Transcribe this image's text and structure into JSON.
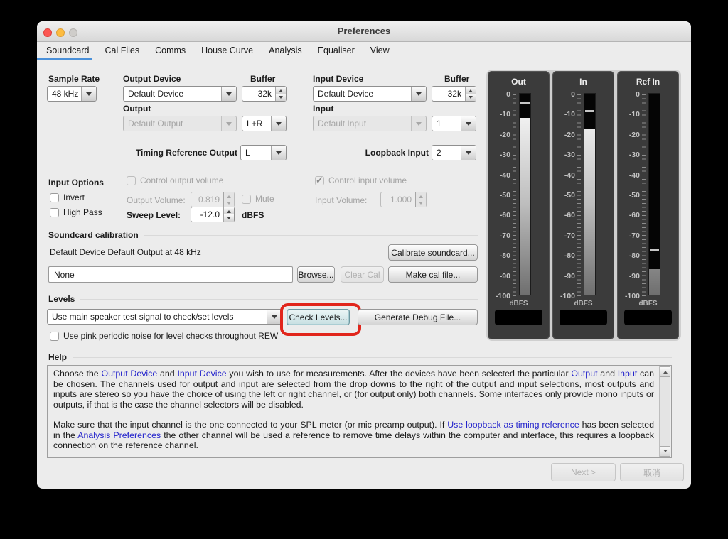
{
  "window": {
    "title": "Preferences"
  },
  "tabs": {
    "items": [
      {
        "label": "Soundcard"
      },
      {
        "label": "Cal Files"
      },
      {
        "label": "Comms"
      },
      {
        "label": "House Curve"
      },
      {
        "label": "Analysis"
      },
      {
        "label": "Equaliser"
      },
      {
        "label": "View"
      }
    ],
    "selected": "Soundcard"
  },
  "controls": {
    "sample_rate_label": "Sample Rate",
    "sample_rate_value": "48 kHz",
    "output_device_label": "Output Device",
    "output_device_value": "Default Device",
    "output_buffer_label": "Buffer",
    "output_buffer_value": "32k",
    "input_device_label": "Input Device",
    "input_device_value": "Default Device",
    "input_buffer_label": "Buffer",
    "input_buffer_value": "32k",
    "output_label": "Output",
    "output_value": "Default Output",
    "output_channel_value": "L+R",
    "input_label": "Input",
    "input_value": "Default Input",
    "input_channel_value": "1",
    "timing_ref_label": "Timing Reference Output",
    "timing_ref_value": "L",
    "loopback_label": "Loopback Input",
    "loopback_value": "2"
  },
  "input_options": {
    "section_label": "Input Options",
    "invert_label": "Invert",
    "high_pass_label": "High Pass",
    "control_output_label": "Control output volume",
    "output_volume_label": "Output Volume:",
    "output_volume_value": "0.819",
    "mute_label": "Mute",
    "sweep_level_label": "Sweep Level:",
    "sweep_level_value": "-12.0",
    "sweep_level_unit": "dBFS",
    "control_input_label": "Control input volume",
    "input_volume_label": "Input Volume:",
    "input_volume_value": "1.000"
  },
  "calibration": {
    "section_label": "Soundcard calibration",
    "status_text": "Default Device Default Output at 48 kHz",
    "file_value": "None",
    "browse_label": "Browse...",
    "clear_label": "Clear Cal",
    "make_label": "Make cal file...",
    "calibrate_label": "Calibrate soundcard..."
  },
  "levels": {
    "section_label": "Levels",
    "signal_select_value": "Use main speaker test signal to check/set levels",
    "check_levels_label": "Check Levels...",
    "generate_debug_label": "Generate Debug File...",
    "pink_noise_label": "Use pink periodic noise for level checks throughout REW"
  },
  "help": {
    "section_label": "Help",
    "paragraphs": [
      [
        {
          "t": "Choose the "
        },
        {
          "t": "Output Device",
          "link": true
        },
        {
          "t": " and "
        },
        {
          "t": "Input Device",
          "link": true
        },
        {
          "t": " you wish to use for measurements. After the devices have been selected the particular "
        },
        {
          "t": "Output",
          "link": true
        },
        {
          "t": " and "
        },
        {
          "t": "Input",
          "link": true
        },
        {
          "t": " can be chosen. The channels used for output and input are selected from the drop downs to the right of the output and input selections, most outputs and inputs are stereo so you have the choice of using the left or right channel, or (for output only) both channels. Some interfaces only provide mono inputs or outputs, if that is the case the channel selectors will be disabled."
        }
      ],
      [
        {
          "t": "Make sure that the input channel is the one connected to your SPL meter (or mic preamp output). If "
        },
        {
          "t": "Use loopback as timing reference",
          "link": true
        },
        {
          "t": " has been selected in the "
        },
        {
          "t": "Analysis Preferences",
          "link": true
        },
        {
          "t": " the other channel will be used a reference to remove time delays within the computer and interface, this requires a loopback connection on the reference channel."
        }
      ]
    ]
  },
  "meters": {
    "unit_label": "dBFS",
    "scale": [
      "0",
      "-10",
      "-20",
      "-30",
      "-40",
      "-50",
      "-60",
      "-70",
      "-80",
      "-90",
      "-100"
    ],
    "items": [
      {
        "label": "Out",
        "level_db": -12,
        "peak_db": -4
      },
      {
        "label": "In",
        "level_db": -17.5,
        "peak_db": -8
      },
      {
        "label": "Ref In",
        "level_db": -87,
        "peak_db": -77
      }
    ]
  },
  "footer": {
    "next_label": "Next >",
    "cancel_label": "取消"
  },
  "colors": {
    "accent_blue": "#4a90d9",
    "link_blue": "#2323cc",
    "annotation_red": "#e1251b",
    "meter_panel": "#3b3b3b"
  }
}
